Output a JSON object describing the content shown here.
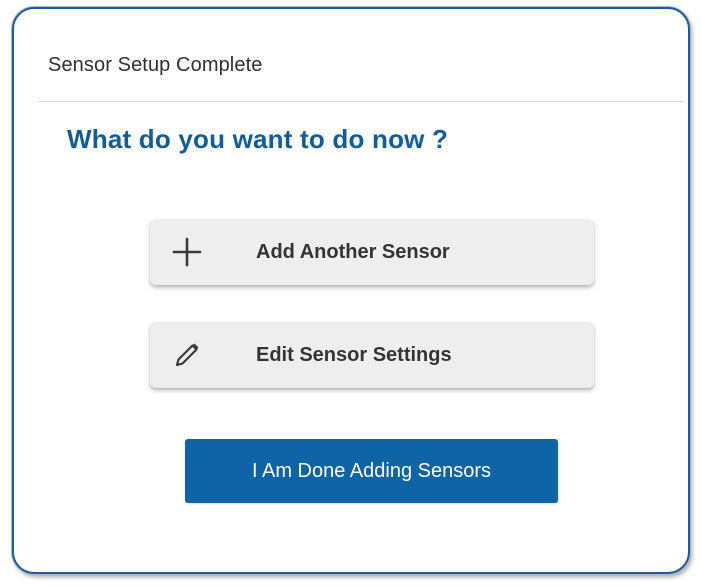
{
  "dialog": {
    "title": "Sensor Setup Complete",
    "question": "What do you want to do now ?",
    "options": [
      {
        "label": "Add Another Sensor",
        "icon": "plus-icon"
      },
      {
        "label": "Edit Sensor Settings",
        "icon": "pencil-icon"
      }
    ],
    "primary_button": {
      "label": "I Am Done Adding Sensors"
    }
  },
  "colors": {
    "border": "#1b5d9a",
    "heading": "#0f5d9e",
    "primary": "#0f64a8",
    "option_background": "#eeeeef",
    "text": "#343434"
  }
}
